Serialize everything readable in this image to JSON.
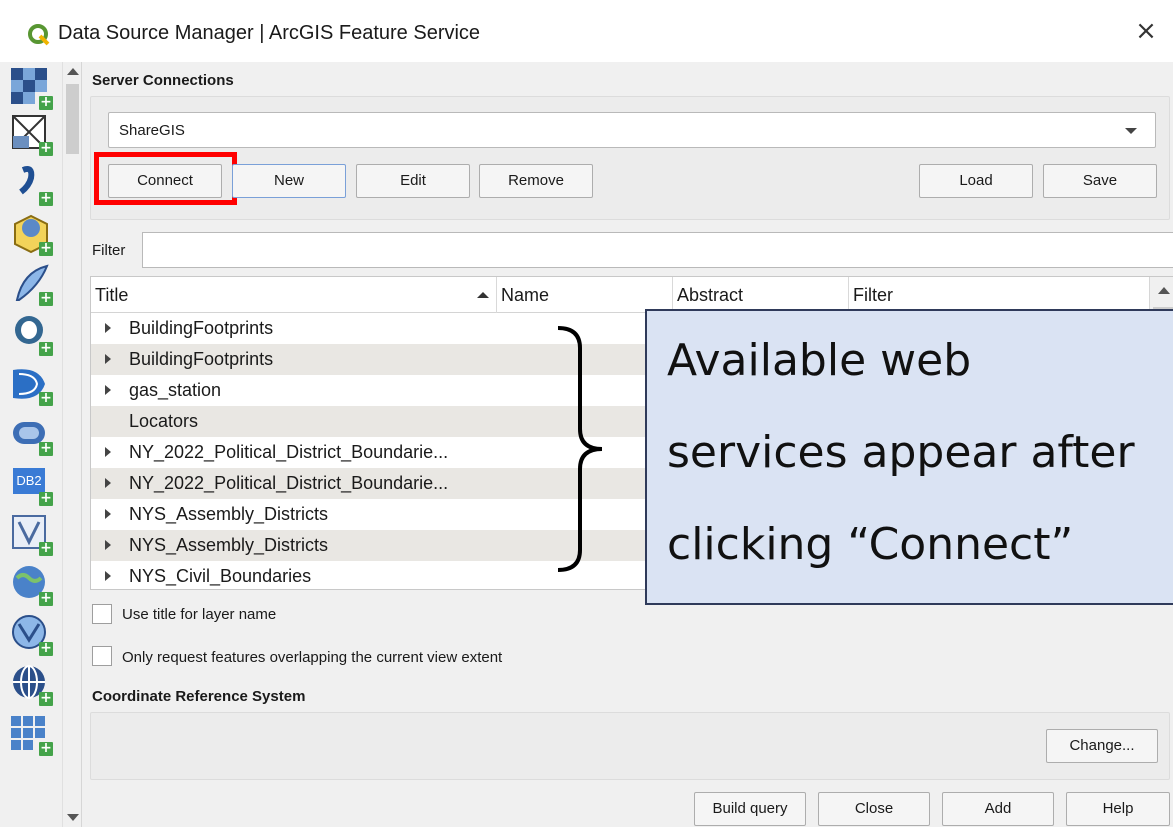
{
  "window": {
    "title": "Data Source Manager | ArcGIS Feature Service",
    "close_glyph": "×"
  },
  "icons": {
    "app": "qgis-logo-icon",
    "sources": [
      "raster-layer-icon",
      "vector-layer-icon",
      "delimited-text-icon",
      "geopackage-icon",
      "spatialite-icon",
      "postgis-icon",
      "mssql-icon",
      "oracle-icon",
      "db2-icon",
      "virtual-layer-icon",
      "wms-icon",
      "wfs-icon",
      "wcs-icon",
      "xyz-tiles-icon"
    ],
    "db2_text": "DB2"
  },
  "server_connections": {
    "heading": "Server Connections",
    "selected_connection": "ShareGIS",
    "buttons": {
      "connect": "Connect",
      "new": "New",
      "edit": "Edit",
      "remove": "Remove",
      "load": "Load",
      "save": "Save"
    }
  },
  "filter": {
    "label": "Filter",
    "value": ""
  },
  "table": {
    "columns": [
      "Title",
      "Name",
      "Abstract",
      "Filter"
    ],
    "rows": [
      {
        "title": "BuildingFootprints",
        "expandable": true
      },
      {
        "title": "BuildingFootprints",
        "expandable": true
      },
      {
        "title": "gas_station",
        "expandable": true
      },
      {
        "title": "Locators",
        "expandable": false
      },
      {
        "title": "NY_2022_Political_District_Boundarie...",
        "expandable": true
      },
      {
        "title": "NY_2022_Political_District_Boundarie...",
        "expandable": true
      },
      {
        "title": "NYS_Assembly_Districts",
        "expandable": true
      },
      {
        "title": "NYS_Assembly_Districts",
        "expandable": true
      },
      {
        "title": "NYS_Civil_Boundaries",
        "expandable": true
      }
    ]
  },
  "options": {
    "use_title": "Use title for layer name",
    "only_request": "Only request features overlapping the current view extent"
  },
  "crs": {
    "heading": "Coordinate Reference System",
    "change_button": "Change..."
  },
  "bottom_buttons": {
    "build_query": "Build query",
    "close": "Close",
    "add": "Add",
    "help": "Help"
  },
  "callout": {
    "lines": [
      "Available web",
      "services appear after",
      "clicking “Connect”"
    ]
  },
  "colors": {
    "highlight": "#ff0000",
    "callout_bg": "#dae3f3",
    "plus_badge": "#44a34a",
    "row_alt": "#e9e7e3"
  }
}
